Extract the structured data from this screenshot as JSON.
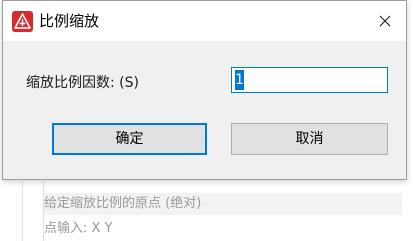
{
  "dialog": {
    "title": "比例缩放",
    "icon": "app-logo-icon",
    "close_icon": "close-icon",
    "accent_color": "#0078d7",
    "icon_color": "#d42c2c"
  },
  "form": {
    "label": "缩放比例因数: (S)",
    "value": "1"
  },
  "buttons": {
    "ok_label": "确定",
    "cancel_label": "取消"
  },
  "background": {
    "prompt_line": "给定缩放比例的原点 (绝对)",
    "input_line": "点输入: X Y"
  }
}
